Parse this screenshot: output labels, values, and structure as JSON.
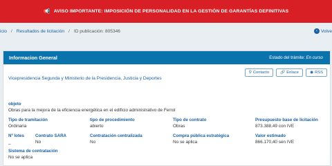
{
  "alert": {
    "icon": "megaphone-icon",
    "text": "AVISO IMPORTANTE: IMPOSICIÓN DE PERSONALIDAD EN LA GESTIÓN DE GARANTÍAS DEFINITIVAS",
    "color": "#d81f26"
  },
  "breadcrumb": {
    "items": [
      "icio",
      "Resultados de licitación",
      "ID publicación: 805346"
    ],
    "back_label": "Volve"
  },
  "card": {
    "title": "Informacion General",
    "status_label": "Estado del trámite:",
    "status_value": "En curso",
    "organization": "Vicepresidencia Segunda y Ministerio de la Presidencia, Justicia y Deportes",
    "buttons": [
      {
        "icon": "location-pin-icon",
        "label": "Contacto"
      },
      {
        "icon": "link-icon",
        "label": "Enlace"
      },
      {
        "icon": "rss-icon",
        "label": "RSS"
      }
    ],
    "fields": {
      "objeto": {
        "label": "objeto",
        "value": "Obras para la mejora de la eficiencia energética en el edificio administrativo de Ferrol"
      },
      "tipo_tramitacion": {
        "label": "Tipo de tramitación",
        "value": "Ordinaria"
      },
      "tipo_procedimiento": {
        "label": "tipo de procedimiento",
        "value": "abierto"
      },
      "tipo_contrato": {
        "label": "Tipo de contrato",
        "value": "Obras"
      },
      "presupuesto": {
        "label": "Presupuesto base de licitación",
        "value": "873.388,49 con IVE"
      },
      "n_lotes": {
        "label": "Nº lotes",
        "value": "_"
      },
      "contrato_sara": {
        "label": "Contrato SARA",
        "value": "No"
      },
      "contratacion_centralizada": {
        "label": "Contratación centralizada",
        "value": "No"
      },
      "compra_publica": {
        "label": "Compra pública estratégica",
        "value": "No se aplica"
      },
      "valor_estimado": {
        "label": "Valor estimado",
        "value": "866.170,40 sen IVE"
      },
      "sistema_contratacion": {
        "label": "Sistema de contratación",
        "value": "No se aplica"
      }
    }
  },
  "colors": {
    "primary": "#0b73ac",
    "link": "#1a5fa0"
  }
}
